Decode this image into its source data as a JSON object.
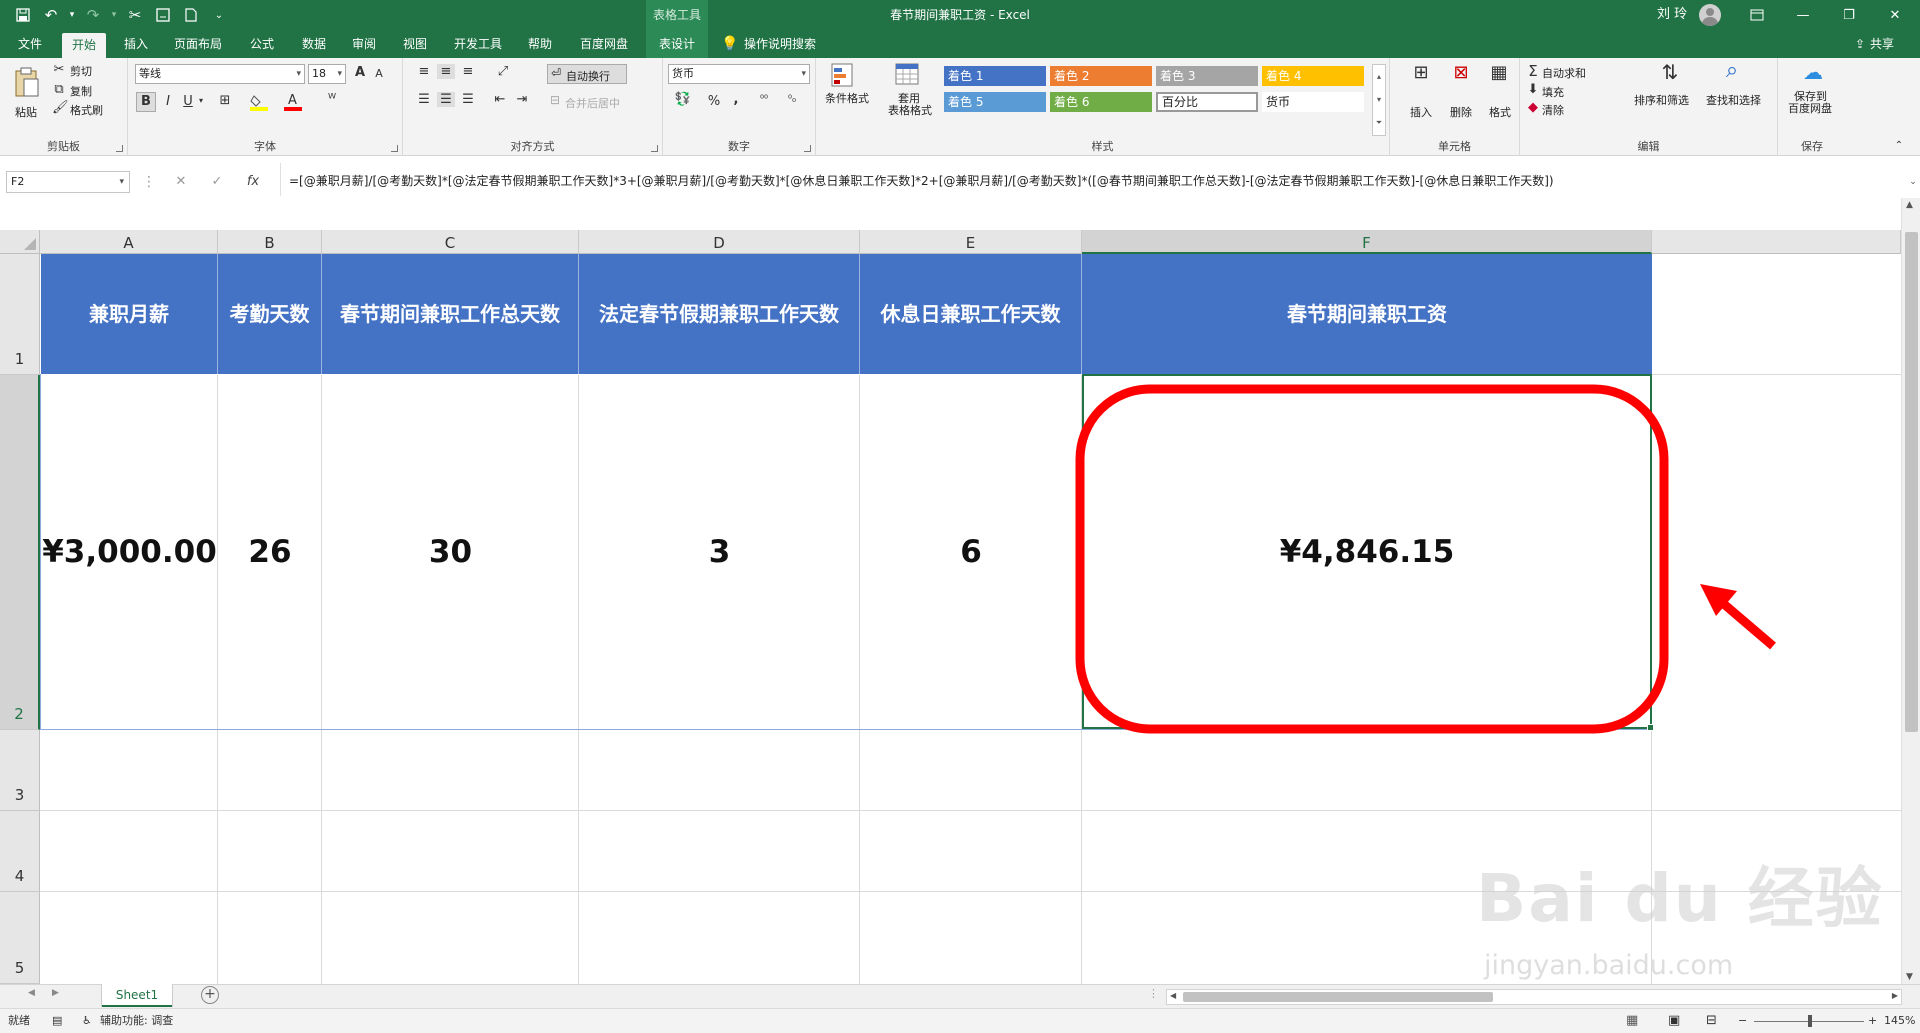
{
  "title_bar": {
    "context_tab": "表格工具",
    "document_title": "春节期间兼职工资",
    "app_name": "Excel",
    "title_separator": " - ",
    "user_name": "刘 玲"
  },
  "ribbon_tabs": [
    "文件",
    "开始",
    "插入",
    "页面布局",
    "公式",
    "数据",
    "审阅",
    "视图",
    "开发工具",
    "帮助",
    "百度网盘",
    "表设计"
  ],
  "active_tab": "开始",
  "tell_me": "操作说明搜索",
  "share_label": "共享",
  "clipboard": {
    "paste": "粘贴",
    "cut": "剪切",
    "copy": "复制",
    "format_painter": "格式刷",
    "label": "剪贴板"
  },
  "font": {
    "name": "等线",
    "size": "18",
    "label": "字体",
    "bold": "B",
    "italic": "I",
    "underline": "U",
    "grow": "A",
    "shrink": "A",
    "fill_color": "#ffff00",
    "font_color": "#ff0000"
  },
  "alignment": {
    "wrap_text": "自动换行",
    "merge_center": "合并后居中",
    "label": "对齐方式"
  },
  "number": {
    "format": "货币",
    "percent": "%",
    "comma": ",",
    "label": "数字"
  },
  "styles": {
    "conditional_formatting": "条件格式",
    "format_as_table_line1": "套用",
    "format_as_table_line2": "表格格式",
    "label": "样式",
    "gallery": [
      {
        "name": "着色 1",
        "color": "#4472c4",
        "text_color": "#ffffff"
      },
      {
        "name": "着色 2",
        "color": "#ed7d31",
        "text_color": "#ffffff"
      },
      {
        "name": "着色 3",
        "color": "#a5a5a5",
        "text_color": "#ffffff"
      },
      {
        "name": "着色 4",
        "color": "#ffc000",
        "text_color": "#ffffff"
      },
      {
        "name": "着色 5",
        "color": "#5b9bd5",
        "text_color": "#ffffff"
      },
      {
        "name": "着色 6",
        "color": "#70ad47",
        "text_color": "#ffffff"
      },
      {
        "name": "百分比",
        "color": "#ffffff",
        "text_color": "#222222"
      },
      {
        "name": "货币",
        "color": "#ffffff",
        "text_color": "#222222"
      }
    ]
  },
  "cells_group": {
    "insert": "插入",
    "delete": "删除",
    "format": "格式",
    "label": "单元格"
  },
  "editing": {
    "autosum": "自动求和",
    "fill": "填充",
    "clear": "清除",
    "sort_filter": "排序和筛选",
    "find_select": "查找和选择",
    "label": "编辑"
  },
  "save_group": {
    "save_line1": "保存到",
    "save_line2": "百度网盘",
    "label": "保存"
  },
  "formula_bar": {
    "name_box": "F2",
    "fx": "fx",
    "formula": "=[@兼职月薪]/[@考勤天数]*[@法定春节假期兼职工作天数]*3+[@兼职月薪]/[@考勤天数]*[@休息日兼职工作天数]*2+[@兼职月薪]/[@考勤天数]*([@春节期间兼职工作总天数]-[@法定春节假期兼职工作天数]-[@休息日兼职工作天数])"
  },
  "columns": [
    "A",
    "B",
    "C",
    "D",
    "E",
    "F"
  ],
  "rows": [
    "1",
    "2",
    "3",
    "4",
    "5"
  ],
  "table": {
    "header_color": "#4472c4",
    "headers": [
      "兼职月薪",
      "考勤天数",
      "春节期间兼职工作总天数",
      "法定春节假期兼职工作天数",
      "休息日兼职工作天数",
      "春节期间兼职工资"
    ],
    "values": [
      "¥3,000.00",
      "26",
      "30",
      "3",
      "6",
      "¥4,846.15"
    ]
  },
  "selected_cell": "F2",
  "annotation_color": "#ff0000",
  "sheet_tabs": [
    "Sheet1"
  ],
  "status_bar": {
    "mode": "就绪",
    "accessibility": "辅助功能: 调查",
    "zoom": "145%"
  },
  "watermark": {
    "text": "Bai du 经验",
    "url": "jingyan.baidu.com"
  }
}
